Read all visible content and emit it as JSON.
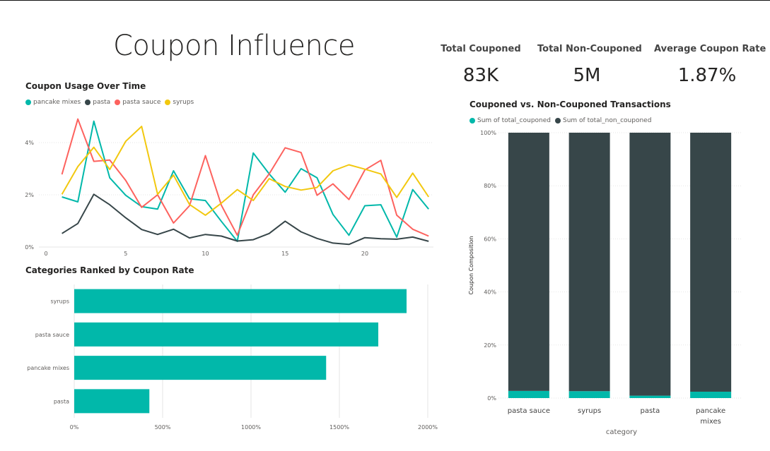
{
  "page": {
    "title": "Coupon Influence"
  },
  "kpis": [
    {
      "label": "Total Couponed",
      "value": "83K"
    },
    {
      "label": "Total Non-Couponed",
      "value": "5M"
    },
    {
      "label": "Average Coupon Rate",
      "value": "1.87%"
    }
  ],
  "colors": {
    "teal": "#01b8aa",
    "dark": "#374649",
    "red": "#fd625e",
    "yellow": "#f2c80f",
    "grid": "#e6e6e6",
    "tick": "#605e5c"
  },
  "chart_data": [
    {
      "id": "usage",
      "type": "line",
      "title": "Coupon Usage Over Time",
      "x": [
        1,
        2,
        3,
        4,
        5,
        6,
        7,
        8,
        9,
        10,
        11,
        12,
        13,
        14,
        15,
        16,
        17,
        18,
        19,
        20,
        21,
        22,
        23,
        24
      ],
      "xticks": [
        0,
        5,
        10,
        15,
        20
      ],
      "xlim": [
        0,
        24.3
      ],
      "yticks": [
        0,
        2,
        4
      ],
      "ytick_labels": [
        "0%",
        "2%",
        "4%"
      ],
      "ylim": [
        0,
        5
      ],
      "legend_position": "top-left",
      "series": [
        {
          "name": "pancake mixes",
          "color": "#01b8aa",
          "values": [
            1.92,
            1.73,
            4.82,
            2.65,
            1.98,
            1.55,
            1.45,
            2.92,
            1.85,
            1.78,
            0.98,
            0.22,
            3.6,
            2.8,
            2.1,
            3.0,
            2.65,
            1.25,
            0.45,
            1.58,
            1.62,
            0.38,
            2.2,
            1.45
          ]
        },
        {
          "name": "pasta",
          "color": "#374649",
          "values": [
            0.52,
            0.9,
            2.02,
            1.62,
            1.12,
            0.67,
            0.48,
            0.68,
            0.35,
            0.48,
            0.42,
            0.23,
            0.28,
            0.52,
            0.99,
            0.58,
            0.33,
            0.15,
            0.1,
            0.36,
            0.32,
            0.3,
            0.38,
            0.22
          ]
        },
        {
          "name": "pasta sauce",
          "color": "#fd625e",
          "values": [
            2.78,
            4.9,
            3.28,
            3.33,
            2.55,
            1.52,
            2.0,
            0.92,
            1.58,
            3.5,
            1.6,
            0.45,
            2.0,
            2.8,
            3.8,
            3.62,
            1.98,
            2.42,
            1.82,
            2.95,
            3.32,
            1.22,
            0.68,
            0.42
          ]
        },
        {
          "name": "syrups",
          "color": "#f2c80f",
          "values": [
            2.02,
            3.08,
            3.82,
            2.97,
            4.05,
            4.62,
            2.02,
            2.75,
            1.63,
            1.22,
            1.68,
            2.2,
            1.78,
            2.62,
            2.32,
            2.18,
            2.28,
            2.92,
            3.15,
            2.98,
            2.8,
            1.9,
            2.83,
            1.92
          ]
        }
      ]
    },
    {
      "id": "ranked",
      "type": "bar",
      "orientation": "horizontal",
      "title": "Categories Ranked by Coupon Rate",
      "categories": [
        "syrups",
        "pasta sauce",
        "pancake mixes",
        "pasta"
      ],
      "values": [
        1880,
        1720,
        1425,
        425
      ],
      "xlim": [
        0,
        2000
      ],
      "xticks": [
        0,
        500,
        1000,
        1500,
        2000
      ],
      "xtick_labels": [
        "0%",
        "500%",
        "1000%",
        "1500%",
        "2000%"
      ],
      "color": "#01b8aa"
    },
    {
      "id": "composition",
      "type": "bar",
      "orientation": "vertical",
      "stacked": "100%",
      "title": "Couponed vs. Non-Couponed Transactions",
      "xlabel": "category",
      "ylabel": "Coupon Composition",
      "categories": [
        [
          "pasta sauce"
        ],
        [
          "syrups"
        ],
        [
          "pasta"
        ],
        [
          "pancake",
          "mixes"
        ]
      ],
      "yticks": [
        0,
        20,
        40,
        60,
        80,
        100
      ],
      "ytick_labels": [
        "0%",
        "20%",
        "40%",
        "60%",
        "80%",
        "100%"
      ],
      "legend_position": "top-left",
      "series": [
        {
          "name": "Sum of total_couponed",
          "color": "#01b8aa",
          "values": [
            2.7,
            2.6,
            0.9,
            2.4
          ]
        },
        {
          "name": "Sum of total_non_couponed",
          "color": "#374649",
          "values": [
            97.3,
            97.4,
            99.1,
            97.6
          ]
        }
      ]
    }
  ]
}
